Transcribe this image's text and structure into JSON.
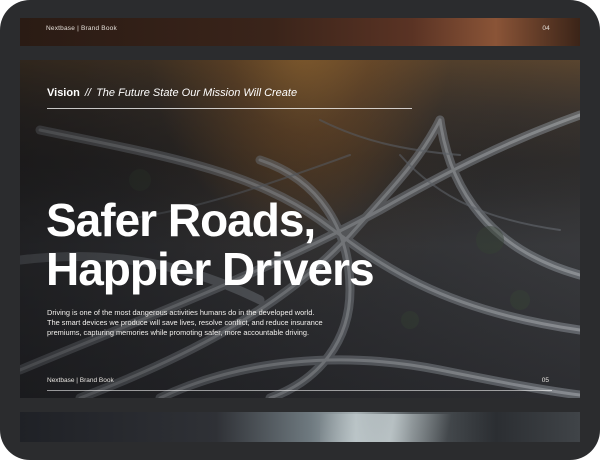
{
  "top_slide": {
    "brand": "Nextbase | Brand Book",
    "page_number": "04"
  },
  "main_slide": {
    "vision_label": "Vision",
    "vision_separator": "//",
    "vision_subtitle": "The Future State Our Mission Will Create",
    "headline_line1": "Safer Roads,",
    "headline_line2": "Happier Drivers",
    "body": "Driving is one of the most dangerous activities humans do in the developed world. The smart devices we produce will save lives, resolve conflict, and reduce insurance premiums, capturing memories while promoting safer, more accountable driving.",
    "footer_brand": "Nextbase | Brand Book",
    "footer_page_number": "05"
  },
  "colors": {
    "frame": "#2b2c2e",
    "text": "#ffffff",
    "sunset_accent": "#ffaa3c"
  }
}
